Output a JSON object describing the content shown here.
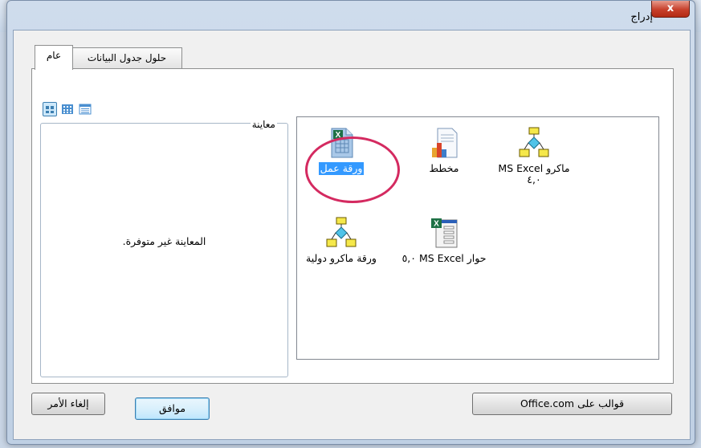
{
  "dialog": {
    "title": "إدراج",
    "close_label": "x"
  },
  "tabs": [
    {
      "label": "عام",
      "active": true
    },
    {
      "label": "حلول جدول البيانات",
      "active": false
    }
  ],
  "view_buttons": [
    {
      "icon": "large-icons-view-icon",
      "active": true
    },
    {
      "icon": "list-view-icon",
      "active": false
    },
    {
      "icon": "details-view-icon",
      "active": false
    }
  ],
  "preview": {
    "label": "معاينة",
    "message": "المعاينة غير متوفرة."
  },
  "items": [
    {
      "label": "ورقة عمل",
      "icon": "worksheet-icon",
      "selected": true
    },
    {
      "label": "مخطط",
      "icon": "chart-icon",
      "selected": false
    },
    {
      "label": "ماكرو MS Excel ٤,٠",
      "icon": "macro-sheet-icon",
      "selected": false
    },
    {
      "label": "ورقة ماكرو دولية",
      "icon": "intl-macro-sheet-icon",
      "selected": false
    },
    {
      "label": "حوار MS Excel ٥,٠",
      "icon": "dialog-sheet-icon",
      "selected": false
    }
  ],
  "buttons": {
    "cancel": "إلغاء الأمر",
    "ok": "موافق",
    "templates": "قوالب على Office.com"
  },
  "colors": {
    "selection": "#3399ff",
    "highlight_ring": "#d42a60",
    "close_button": "#c7402b"
  }
}
